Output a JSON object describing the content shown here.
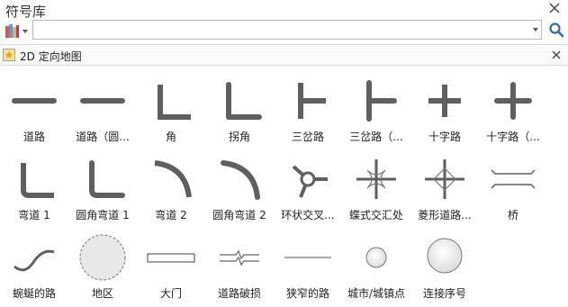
{
  "window": {
    "title": "符号库"
  },
  "search": {
    "value": "",
    "placeholder": ""
  },
  "library": {
    "name": "2D 定向地图"
  },
  "symbols": [
    {
      "icon": "road-icon",
      "label": "道路"
    },
    {
      "icon": "road-rounded-icon",
      "label": "道路（圆..."
    },
    {
      "icon": "corner-icon",
      "label": "角"
    },
    {
      "icon": "turn-corner-icon",
      "label": "拐角"
    },
    {
      "icon": "t-junction-icon",
      "label": "三岔路"
    },
    {
      "icon": "t-junction-rounded-icon",
      "label": "三岔路（..."
    },
    {
      "icon": "crossroad-icon",
      "label": "十字路"
    },
    {
      "icon": "crossroad-rounded-icon",
      "label": "十字路（..."
    },
    {
      "icon": "curve-1-icon",
      "label": "弯道 1"
    },
    {
      "icon": "rounded-curve-1-icon",
      "label": "圆角弯道 1"
    },
    {
      "icon": "curve-2-icon",
      "label": "弯道 2"
    },
    {
      "icon": "rounded-curve-2-icon",
      "label": "圆角弯道 2"
    },
    {
      "icon": "roundabout-icon",
      "label": "环状交叉..."
    },
    {
      "icon": "butterfly-interchange-icon",
      "label": "蝶式交汇处"
    },
    {
      "icon": "diamond-interchange-icon",
      "label": "菱形道路..."
    },
    {
      "icon": "bridge-icon",
      "label": "桥"
    },
    {
      "icon": "winding-road-icon",
      "label": "蜿蜒的路"
    },
    {
      "icon": "area-icon",
      "label": "地区"
    },
    {
      "icon": "gate-icon",
      "label": "大门"
    },
    {
      "icon": "broken-road-icon",
      "label": "道路破损"
    },
    {
      "icon": "narrow-road-icon",
      "label": "狭窄的路"
    },
    {
      "icon": "city-town-icon",
      "label": "城市/城镇点"
    },
    {
      "icon": "connection-number-icon",
      "label": "连接序号"
    }
  ]
}
